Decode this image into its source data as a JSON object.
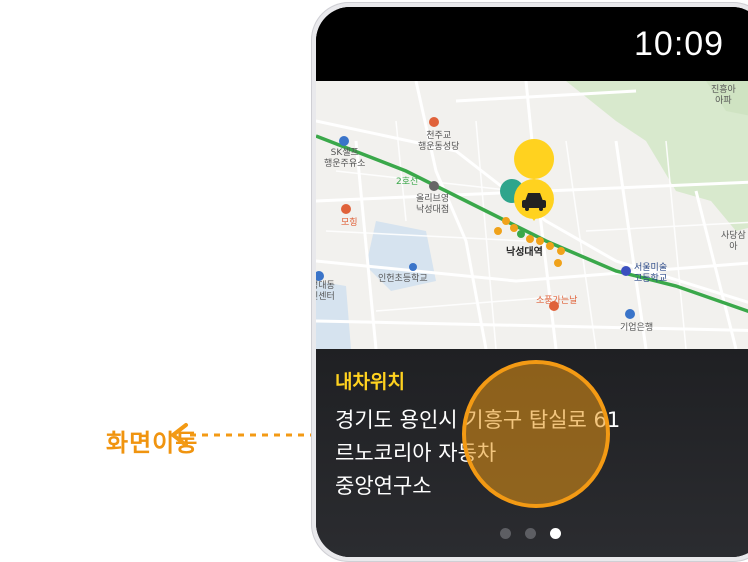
{
  "annotation": {
    "label": "화면이동"
  },
  "status_bar": {
    "time": "10:09"
  },
  "map": {
    "places": [
      {
        "name": "천주교\n행운동성당",
        "kind": "church"
      },
      {
        "name": "SK셀프\n행운주유소",
        "kind": "gas-station"
      },
      {
        "name": "올리브영\n낙성대점",
        "kind": "shop"
      },
      {
        "name": "모힝",
        "kind": "restaurant"
      },
      {
        "name": "낙성대역",
        "kind": "station"
      },
      {
        "name": "인헌초등학교",
        "kind": "school"
      },
      {
        "name": "성대동\n민센터",
        "kind": "civic"
      },
      {
        "name": "서울미술\n고등학교",
        "kind": "school"
      },
      {
        "name": "소풍가는날",
        "kind": "restaurant"
      },
      {
        "name": "기업은행",
        "kind": "bank"
      },
      {
        "name": "진흥아\n아파",
        "kind": "apartment"
      },
      {
        "name": "사당삼\n아",
        "kind": "apartment"
      },
      {
        "name": "2호선",
        "kind": "line-label"
      }
    ],
    "line_color": "#3aa84a",
    "car_marker_color": "#ffd21f"
  },
  "info": {
    "title": "내차위치",
    "line1": "경기도 용인시 기흥구 탑실로 61",
    "line2": "르노코리아 자동차",
    "line3": "중앙연구소"
  },
  "pager": {
    "count": 3,
    "active_index": 2
  },
  "colors": {
    "accent": "#f39a14",
    "title": "#ffd21f"
  }
}
